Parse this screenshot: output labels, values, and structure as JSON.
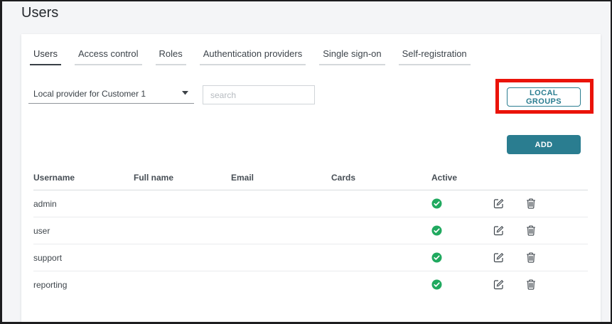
{
  "page": {
    "title": "Users"
  },
  "tabs": [
    {
      "label": "Users",
      "active": true
    },
    {
      "label": "Access control",
      "active": false
    },
    {
      "label": "Roles",
      "active": false
    },
    {
      "label": "Authentication providers",
      "active": false
    },
    {
      "label": "Single sign-on",
      "active": false
    },
    {
      "label": "Self-registration",
      "active": false
    }
  ],
  "toolbar": {
    "provider_dropdown": {
      "selected": "Local provider for Customer 1"
    },
    "search": {
      "placeholder": "search"
    },
    "local_groups_button": "LOCAL GROUPS",
    "add_button": "ADD"
  },
  "table": {
    "columns": [
      "Username",
      "Full name",
      "Email",
      "Cards",
      "Active"
    ],
    "rows": [
      {
        "username": "admin",
        "full_name": "",
        "email": "",
        "cards": "",
        "active": true
      },
      {
        "username": "user",
        "full_name": "",
        "email": "",
        "cards": "",
        "active": true
      },
      {
        "username": "support",
        "full_name": "",
        "email": "",
        "cards": "",
        "active": true
      },
      {
        "username": "reporting",
        "full_name": "",
        "email": "",
        "cards": "",
        "active": true
      }
    ]
  },
  "icons": {
    "dropdown_caret": "caret-down-icon",
    "active_status": "check-circle-icon",
    "edit": "edit-icon",
    "delete": "trash-icon"
  },
  "colors": {
    "accent_teal": "#2a7d90",
    "active_green": "#20a95f",
    "highlight_red": "#ea1309"
  }
}
